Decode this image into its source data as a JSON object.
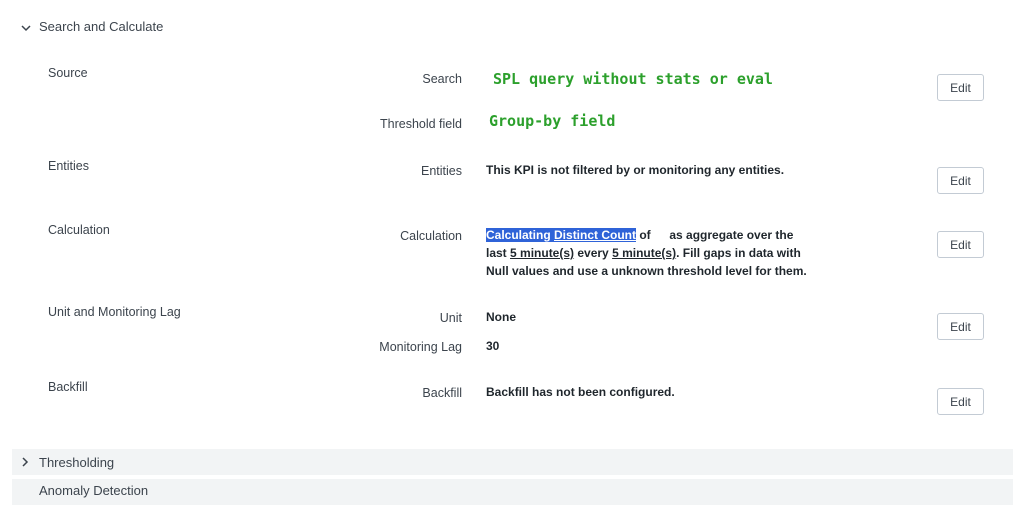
{
  "search_calculate": {
    "title": "Search and Calculate",
    "source": {
      "group_label": "Source",
      "search_label": "Search",
      "search_value": "SPL query without stats or eval",
      "threshold_label": "Threshold field",
      "threshold_value": "Group-by field",
      "edit_label": "Edit"
    },
    "entities": {
      "group_label": "Entities",
      "field_label": "Entities",
      "value": "This KPI is not filtered by or monitoring any entities.",
      "edit_label": "Edit"
    },
    "calculation": {
      "group_label": "Calculation",
      "field_label": "Calculation",
      "part1_highlight_a": "Calculating ",
      "part1_highlight_b": "Distinct Count",
      "part2": " of ",
      "part3": " as aggregate over the",
      "part4": "last ",
      "interval1": "5 minute(s)",
      "part5": " every ",
      "interval2": "5 minute(s)",
      "part6": ". Fill gaps in data with",
      "part7": "Null values and use a unknown threshold level for them.",
      "edit_label": "Edit"
    },
    "unit_lag": {
      "group_label": "Unit and Monitoring Lag",
      "unit_label": "Unit",
      "unit_value": "None",
      "lag_label": "Monitoring Lag",
      "lag_value": "30",
      "edit_label": "Edit"
    },
    "backfill": {
      "group_label": "Backfill",
      "field_label": "Backfill",
      "value": "Backfill has not been configured.",
      "edit_label": "Edit"
    }
  },
  "thresholding": {
    "title": "Thresholding"
  },
  "next_section": {
    "title": "Anomaly Detection"
  },
  "colors": {
    "highlight": "#2f63d8",
    "annotation_green": "#2ca02c"
  }
}
